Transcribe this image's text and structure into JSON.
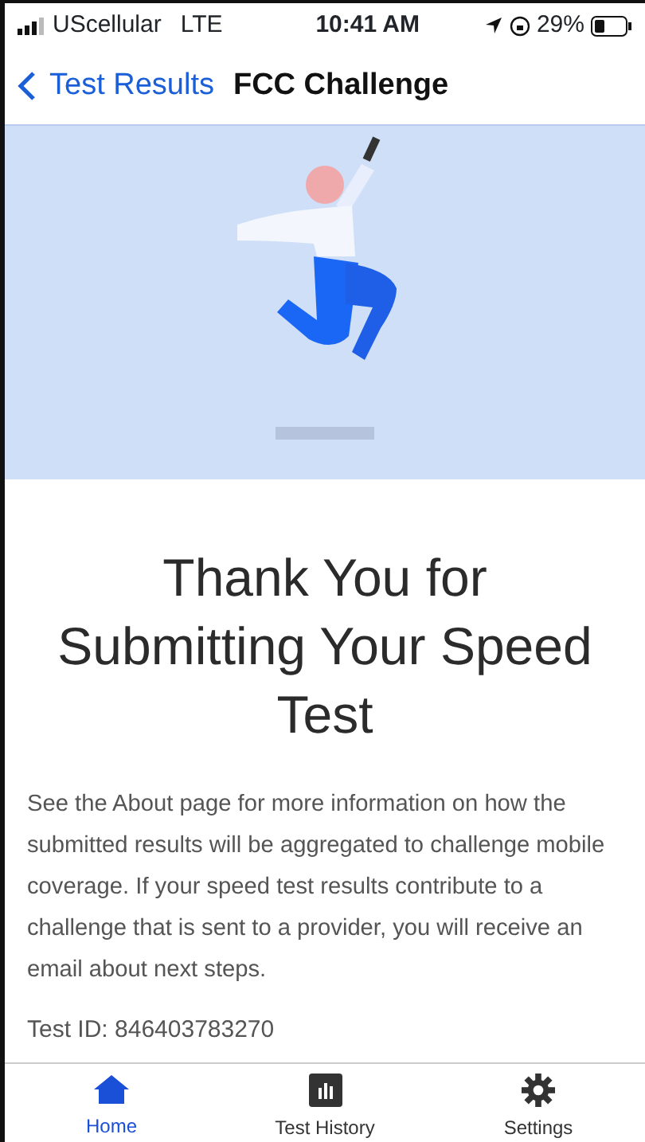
{
  "status_bar": {
    "carrier": "UScellular",
    "network": "LTE",
    "time": "10:41 AM",
    "battery": "29%"
  },
  "nav": {
    "back": "Test Results",
    "title": "FCC Challenge"
  },
  "heading": "Thank You for Submitting Your Speed Test",
  "body": "See the About page for more information on how the submitted results will be aggregated to challenge mobile coverage. If your speed test results contribute to a challenge that is sent to a provider, you will receive an email about next steps.",
  "test_id": "Test ID: 846403783270",
  "tabs": [
    {
      "label": "Home",
      "kind": "home",
      "selected": true
    },
    {
      "label": "Test History",
      "kind": "history",
      "selected": false
    },
    {
      "label": "Settings",
      "kind": "settings",
      "selected": false
    }
  ]
}
